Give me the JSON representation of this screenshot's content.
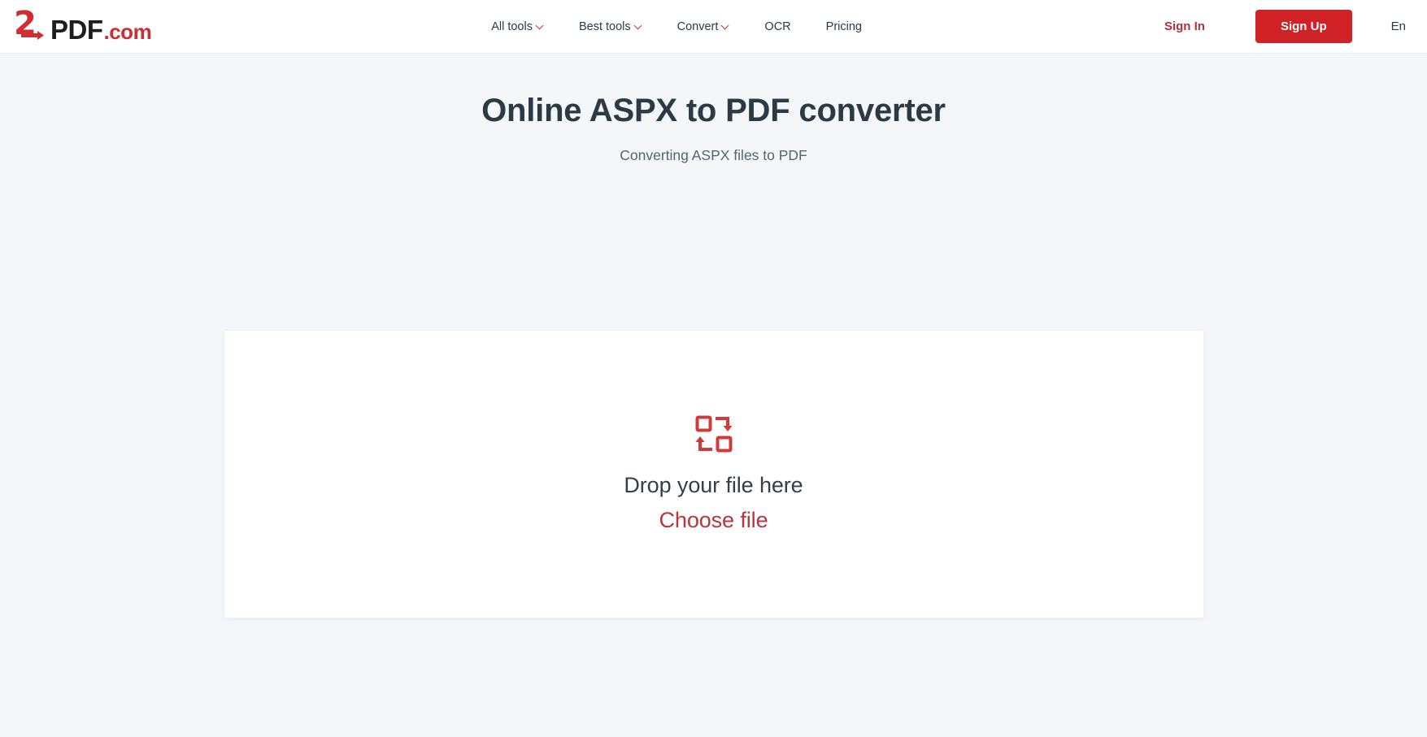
{
  "header": {
    "logo": {
      "digit": "2",
      "main": "PDF",
      "suffix": ".com",
      "arrow_icon": "arrow-right-icon"
    },
    "nav": [
      {
        "label": "All tools",
        "has_dropdown": true,
        "icon": "chevron-down-icon"
      },
      {
        "label": "Best tools",
        "has_dropdown": true,
        "icon": "chevron-down-icon"
      },
      {
        "label": "Convert",
        "has_dropdown": true,
        "icon": "chevron-down-icon"
      },
      {
        "label": "OCR",
        "has_dropdown": false
      },
      {
        "label": "Pricing",
        "has_dropdown": false
      }
    ],
    "sign_in_label": "Sign In",
    "sign_up_label": "Sign Up",
    "language": "En"
  },
  "main": {
    "title": "Online ASPX to PDF converter",
    "subtitle": "Converting ASPX files to PDF",
    "dropzone": {
      "icon": "convert-swap-icon",
      "title": "Drop your file here",
      "choose_label": "Choose file"
    }
  },
  "colors": {
    "brand_red": "#cf2126",
    "link_red": "#b5373c",
    "signin_red": "#b23239",
    "heading": "#2c3a44",
    "subtitle": "#56636d",
    "page_bg": "#f4f7fa",
    "card_bg": "#ffffff",
    "card_border": "#eef1f5"
  }
}
